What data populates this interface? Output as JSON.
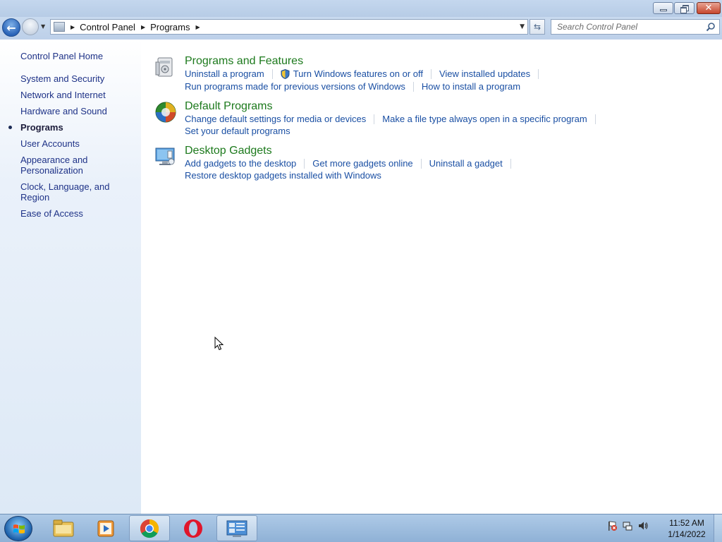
{
  "window": {
    "buttons": {
      "minimize": "minimize",
      "maximize": "restore",
      "close": "close"
    }
  },
  "address": {
    "breadcrumbs": [
      "Control Panel",
      "Programs"
    ],
    "search_placeholder": "Search Control Panel"
  },
  "sidebar": {
    "home": "Control Panel Home",
    "items": [
      {
        "label": "System and Security"
      },
      {
        "label": "Network and Internet"
      },
      {
        "label": "Hardware and Sound"
      },
      {
        "label": "Programs",
        "current": true
      },
      {
        "label": "User Accounts"
      },
      {
        "label": "Appearance and Personalization"
      },
      {
        "label": "Clock, Language, and Region"
      },
      {
        "label": "Ease of Access"
      }
    ]
  },
  "categories": [
    {
      "title": "Programs and Features",
      "icon": "programs-and-features-icon",
      "links_row1": [
        "Uninstall a program",
        "Turn Windows features on or off",
        "View installed updates"
      ],
      "links_row2": [
        "Run programs made for previous versions of Windows",
        "How to install a program"
      ]
    },
    {
      "title": "Default Programs",
      "icon": "default-programs-icon",
      "links_row1": [
        "Change default settings for media or devices",
        "Make a file type always open in a specific program"
      ],
      "links_row2": [
        "Set your default programs"
      ]
    },
    {
      "title": "Desktop Gadgets",
      "icon": "desktop-gadgets-icon",
      "links_row1": [
        "Add gadgets to the desktop",
        "Get more gadgets online",
        "Uninstall a gadget"
      ],
      "links_row2": [
        "Restore desktop gadgets installed with Windows"
      ]
    }
  ],
  "taskbar": {
    "apps": [
      "file-explorer",
      "media-player",
      "chrome",
      "opera",
      "control-panel"
    ],
    "clock_time": "11:52 AM",
    "clock_date": "1/14/2022"
  },
  "colors": {
    "link": "#1a4fa3",
    "category_title": "#1d7a1d",
    "sidebar_link": "#1e3287",
    "close_button": "#c6462d"
  }
}
